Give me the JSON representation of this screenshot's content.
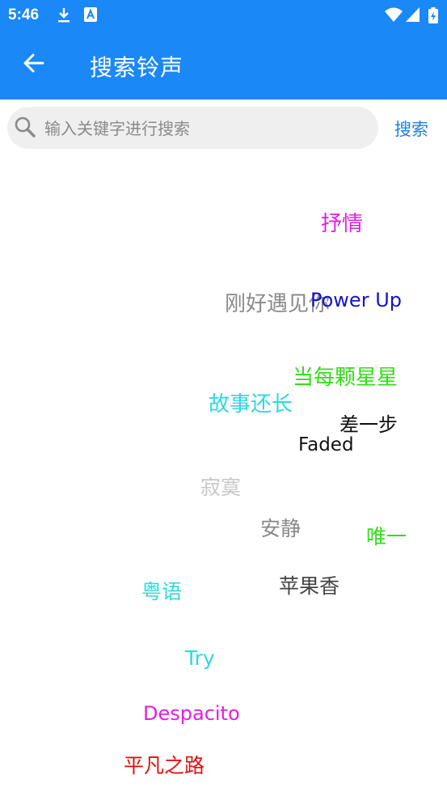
{
  "status_bar": {
    "time": "5:46",
    "icons": [
      "download-icon",
      "a-icon",
      "wifi-icon",
      "signal-icon",
      "battery-icon"
    ]
  },
  "app_bar": {
    "title": "搜索铃声",
    "back_icon": "arrow-left-icon"
  },
  "search": {
    "placeholder": "输入关键字进行搜索",
    "value": "",
    "button_label": "搜索"
  },
  "tags": [
    {
      "text": "抒情",
      "color": "#e11de6"
    },
    {
      "text": "刚好遇见你",
      "color": "#8a8a8a"
    },
    {
      "text": "Power Up",
      "color": "#1414c8"
    },
    {
      "text": "当每颗星星",
      "color": "#33dd1a"
    },
    {
      "text": "故事还长",
      "color": "#2fd8e0"
    },
    {
      "text": "差一步",
      "color": "#111111"
    },
    {
      "text": "Faded",
      "color": "#111111"
    },
    {
      "text": "寂寞",
      "color": "#c8c8c8"
    },
    {
      "text": "安静",
      "color": "#888888"
    },
    {
      "text": "唯一",
      "color": "#33dd1a"
    },
    {
      "text": "苹果香",
      "color": "#444444"
    },
    {
      "text": "粤语",
      "color": "#2fd8e0"
    },
    {
      "text": "Try",
      "color": "#2fd8e0"
    },
    {
      "text": "Despacito",
      "color": "#e11de6"
    },
    {
      "text": "平凡之路",
      "color": "#dd1111"
    }
  ]
}
